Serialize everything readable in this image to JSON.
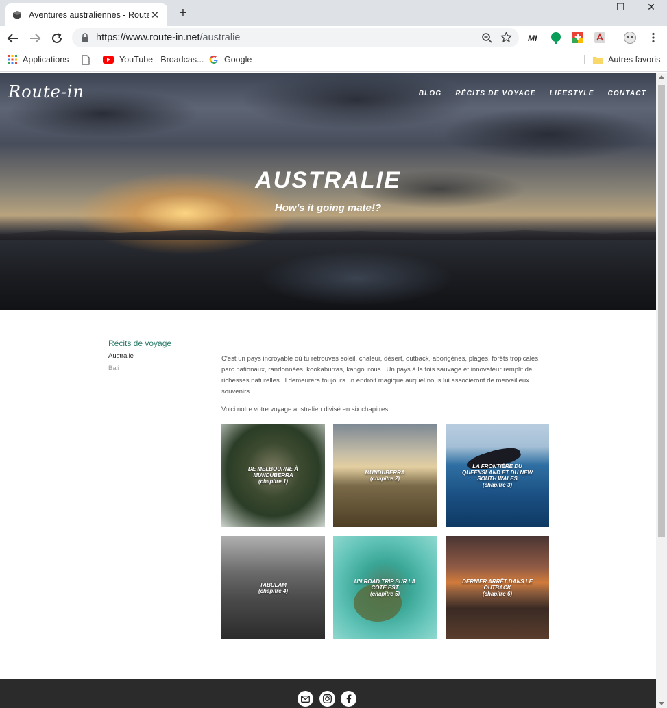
{
  "browser": {
    "tab_title": "Aventures australiennes - Route-in",
    "tab_close": "✕",
    "new_tab": "+",
    "window_controls": {
      "minimize": "—",
      "maximize": "☐",
      "close": "✕"
    },
    "url_host": "https://www.route-in.net",
    "url_path": "/australie"
  },
  "bookmarks": {
    "items": [
      {
        "label": "Applications",
        "icon": "apps-grid-icon"
      },
      {
        "label": "",
        "icon": "page-icon"
      },
      {
        "label": "YouTube - Broadcas...",
        "icon": "youtube-icon"
      },
      {
        "label": "Google",
        "icon": "google-icon"
      }
    ],
    "other": "Autres favoris"
  },
  "site": {
    "logo": "Route-in",
    "nav": [
      "Blog",
      "Récits de voyage",
      "Lifestyle",
      "Contact"
    ],
    "hero_title": "AUSTRALIE",
    "hero_subtitle": "How's it going mate!?"
  },
  "sidebar": {
    "heading": "Récits de voyage",
    "current": "Australie",
    "other": "Bali"
  },
  "content": {
    "paragraph1": "C'est un pays incroyable où tu retrouves soleil, chaleur, désert, outback, aborigènes, plages, forêts tropicales, parc nationaux, randonnées, kookaburras, kangourous...Un pays à la fois sauvage et innovateur remplit de richesses naturelles. Il demeurera toujours un endroit magique auquel nous lui associeront de merveilleux souvenirs.",
    "paragraph2": "Voici notre votre voyage australien divisé en six chapitres."
  },
  "chapters": [
    {
      "title": "De Melbourne à Munduberra",
      "chapter": "(chapitre 1)"
    },
    {
      "title": "Munduberra",
      "chapter": "(chapitre 2)"
    },
    {
      "title": "La frontière du Queensland et du New South Wales",
      "chapter": "(chapitre 3)"
    },
    {
      "title": "Tabulam",
      "chapter": "(chapitre 4)"
    },
    {
      "title": "Un road trip sur la côte est",
      "chapter": "(chapitre 5)"
    },
    {
      "title": "Dernier arrêt dans le outback",
      "chapter": "(chapitre 6)"
    }
  ],
  "footer": {
    "social": [
      "mail-icon",
      "instagram-icon",
      "facebook-icon"
    ]
  },
  "colors": {
    "sidebar_heading": "#2e7d6b",
    "footer_bg": "#2b2b2b",
    "chrome_bg": "#dee1e6"
  }
}
